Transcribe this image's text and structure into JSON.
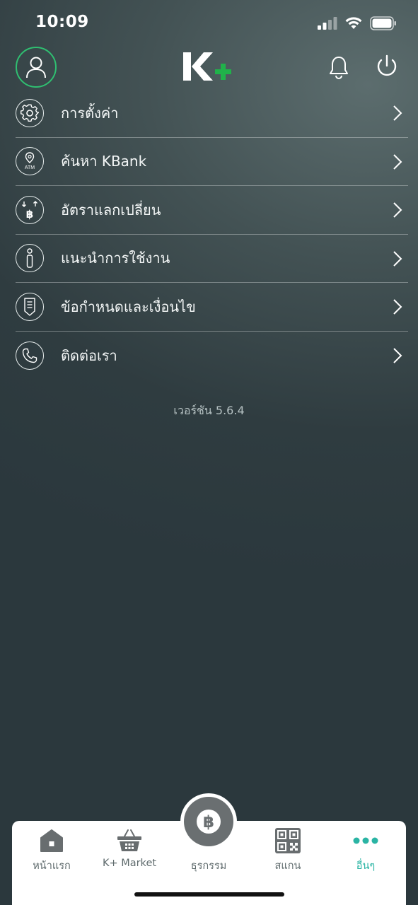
{
  "status_bar": {
    "time": "10:09",
    "icons": [
      "signal-icon",
      "wifi-icon",
      "battery-icon"
    ]
  },
  "header": {
    "logo_text": "K+",
    "icons": [
      "profile-icon",
      "bell-icon",
      "power-icon"
    ]
  },
  "menu": {
    "items": [
      {
        "label": "การตั้งค่า",
        "icon": "gear-icon"
      },
      {
        "label": "ค้นหา KBank",
        "icon": "atm-location-icon"
      },
      {
        "label": "อัตราแลกเปลี่ยน",
        "icon": "exchange-icon"
      },
      {
        "label": "แนะนำการใช้งาน",
        "icon": "info-icon"
      },
      {
        "label": "ข้อกำหนดและเงื่อนไข",
        "icon": "terms-icon"
      },
      {
        "label": "ติดต่อเรา",
        "icon": "phone-icon"
      }
    ]
  },
  "version": "เวอร์ชัน 5.6.4",
  "tabbar": {
    "tabs": [
      {
        "label": "หน้าแรก",
        "icon": "home-icon"
      },
      {
        "label": "K+ Market",
        "icon": "basket-icon"
      },
      {
        "label": "ธุรกรรม",
        "icon": "baht-icon"
      },
      {
        "label": "สแกน",
        "icon": "qr-icon"
      },
      {
        "label": "อื่นๆ",
        "icon": "more-icon",
        "active": true
      }
    ]
  },
  "colors": {
    "accent": "#2fbf71",
    "tab_active": "#2ab4a4",
    "tab_inactive": "#5e6a6c"
  }
}
